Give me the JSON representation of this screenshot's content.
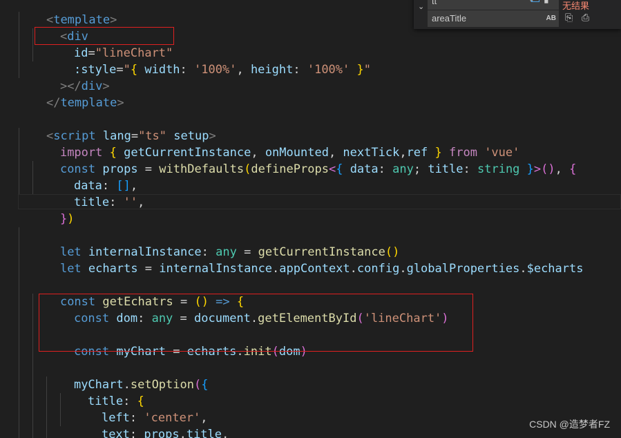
{
  "code": {
    "l1": {
      "open": "<",
      "tag": "template",
      "close": ">"
    },
    "l2": {
      "open": "<",
      "tag": "div"
    },
    "l3": {
      "attr": "id",
      "eq": "=",
      "val": "\"lineChart\""
    },
    "l4": {
      "attr": ":style",
      "eq": "=",
      "q1": "\"",
      "b1": "{",
      "k1": " width",
      "c1": ": ",
      "s1": "'100%'",
      "cm": ", ",
      "k2": "height",
      "c2": ": ",
      "s2": "'100%'",
      "b2": " }",
      "q2": "\""
    },
    "l5": {
      "close": "></",
      "tag": "div",
      "end": ">"
    },
    "l6": {
      "open": "</",
      "tag": "template",
      "close": ">"
    },
    "l8": {
      "open": "<",
      "tag": "script",
      "attr1": " lang",
      "eq": "=",
      "val": "\"ts\"",
      "attr2": " setup",
      "close": ">"
    },
    "l9": {
      "kw": "import",
      "b1": " { ",
      "f1": "getCurrentInstance",
      "p1": ", ",
      "f2": "onMounted",
      "p2": ", ",
      "f3": "nextTick",
      "p3": ",",
      "f4": "ref",
      "b2": " }",
      "from": " from ",
      "src": "'vue'"
    },
    "l10": {
      "kw": "const",
      "v": " props",
      "eq": " = ",
      "fn1": "withDefaults",
      "b1": "(",
      "fn2": "defineProps",
      "lt": "<",
      "b2": "{ ",
      "k1": "data",
      "c1": ": ",
      "t1": "any",
      "sc": "; ",
      "k2": "title",
      "c2": ": ",
      "t2": "string",
      "b3": " }",
      "gt": ">",
      "b4": "()",
      "cm": ", ",
      "b5": "{"
    },
    "l11": {
      "k": "data",
      "c": ": ",
      "v": "[]",
      "cm": ","
    },
    "l12": {
      "k": "title",
      "c": ": ",
      "v": "''",
      "cm": ","
    },
    "l13": {
      "b1": "}",
      "b2": ")"
    },
    "l15": {
      "kw": "let",
      "v": " internalInstance",
      "c": ": ",
      "t": "any",
      "eq": " = ",
      "fn": "getCurrentInstance",
      "b": "()"
    },
    "l16": {
      "kw": "let",
      "v": " echarts",
      "eq": " = ",
      "o": "internalInstance",
      "d1": ".",
      "p1": "appContext",
      "d2": ".",
      "p2": "config",
      "d3": ".",
      "p3": "globalProperties",
      "d4": ".",
      "p4": "$echarts"
    },
    "l18": {
      "kw": "const",
      "fn": " getEchatrs",
      "eq": " = ",
      "b": "()",
      "arrow": " => ",
      "brace": "{"
    },
    "l19": {
      "kw": "const",
      "v": " dom",
      "c": ": ",
      "t": "any",
      "eq": " = ",
      "o": "document",
      "d": ".",
      "fn": "getElementById",
      "b1": "(",
      "s": "'lineChart'",
      "b2": ")"
    },
    "l21": {
      "kw": "const",
      "v": " myChart",
      "eq": " = ",
      "o": "echarts",
      "d": ".",
      "fn": "init",
      "b1": "(",
      "a": "dom",
      "b2": ")"
    },
    "l23": {
      "o": "myChart",
      "d": ".",
      "fn": "setOption",
      "b1": "(",
      "b2": "{"
    },
    "l24": {
      "k": "title",
      "c": ": ",
      "b": "{"
    },
    "l25": {
      "k": "left",
      "c": ": ",
      "s": "'center'",
      "cm": ","
    },
    "l26": {
      "k": "text",
      "c": ": ",
      "o": "props",
      "d": ".",
      "p": "title",
      "cm": ","
    },
    "l27": {
      "b": "},"
    }
  },
  "find_widget": {
    "find_value": "tt",
    "replace_value": "areaTitle",
    "preserve_case_label": "AB",
    "result_text": "无结果"
  },
  "watermark": "CSDN @造梦者FZ"
}
